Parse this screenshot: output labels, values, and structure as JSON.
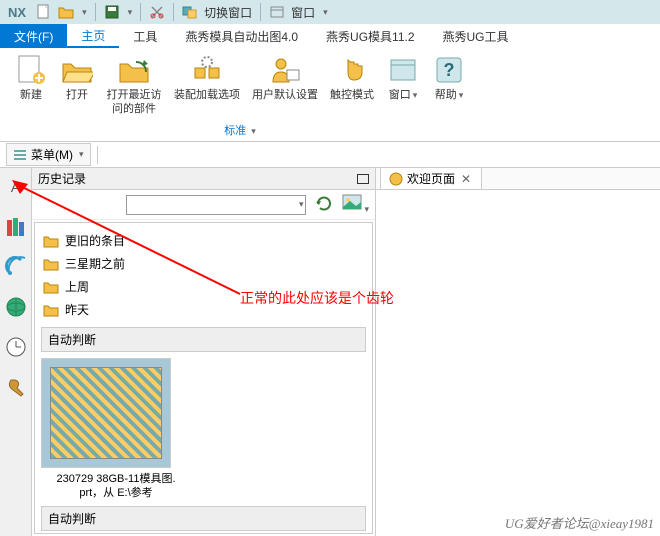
{
  "app": {
    "name": "NX"
  },
  "titlebar": {
    "switch_window": "切换窗口",
    "window": "窗口"
  },
  "tabs": {
    "file": "文件(F)",
    "home": "主页",
    "tools": "工具",
    "yx_auto": "燕秀模具自动出图4.0",
    "yx_ug112": "燕秀UG模具11.2",
    "yx_ugtool": "燕秀UG工具"
  },
  "ribbon": {
    "new": "新建",
    "open": "打开",
    "recent": "打开最近访\n问的部件",
    "assembly": "装配加载选项",
    "user_defaults": "用户默认设置",
    "touch": "触控模式",
    "window": "窗口",
    "help": "帮助",
    "group_std": "标准"
  },
  "menubar": {
    "menu": "菜单(M)"
  },
  "history": {
    "title": "历史记录",
    "folders": [
      "更旧的条目",
      "三星期之前",
      "上周",
      "昨天"
    ],
    "auto_judge": "自动判断",
    "thumb_caption": "230729 38GB-11模具图.\nprt，从 E:\\参考",
    "auto_judge2": "自动判断"
  },
  "welcome": {
    "tab": "欢迎页面"
  },
  "annotation": "正常的此处应该是个齿轮",
  "watermark": "UG爱好者论坛@xieay1981"
}
